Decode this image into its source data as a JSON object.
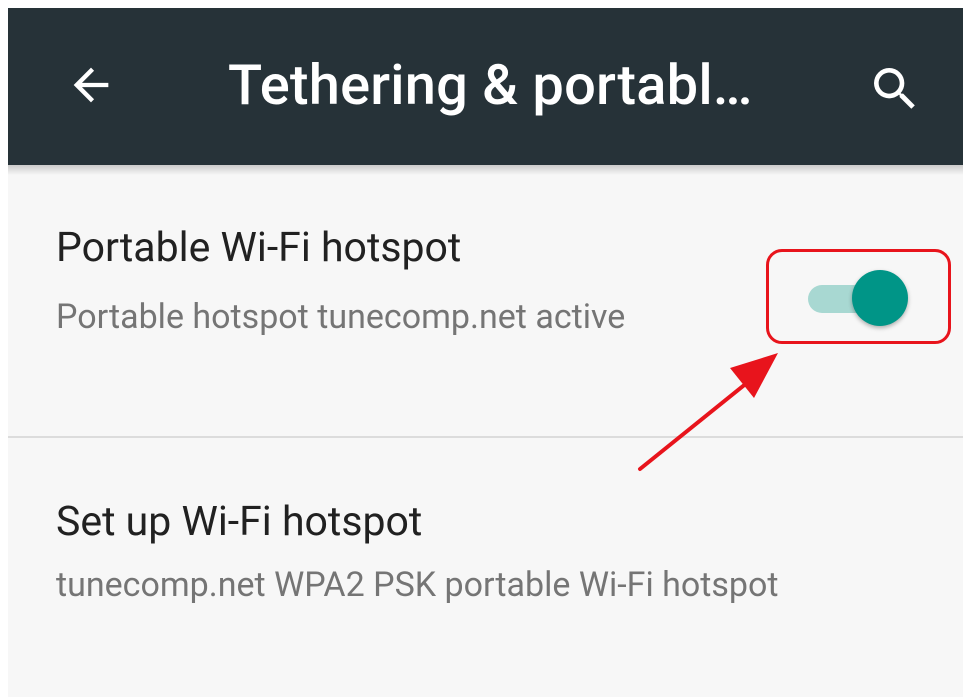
{
  "colors": {
    "toolbar_bg": "#263238",
    "accent": "#009587",
    "track_on": "#a8d8d2",
    "annotation": "#e8141c"
  },
  "toolbar": {
    "back_icon": "arrow-back-icon",
    "title": "Tethering & portabl…",
    "search_icon": "search-icon"
  },
  "settings": {
    "hotspot": {
      "title": "Portable Wi-Fi hotspot",
      "summary": "Portable hotspot tunecomp.net active",
      "switch_on": true
    },
    "setup": {
      "title": "Set up Wi-Fi hotspot",
      "summary": "tunecomp.net WPA2 PSK portable Wi-Fi hotspot"
    }
  }
}
